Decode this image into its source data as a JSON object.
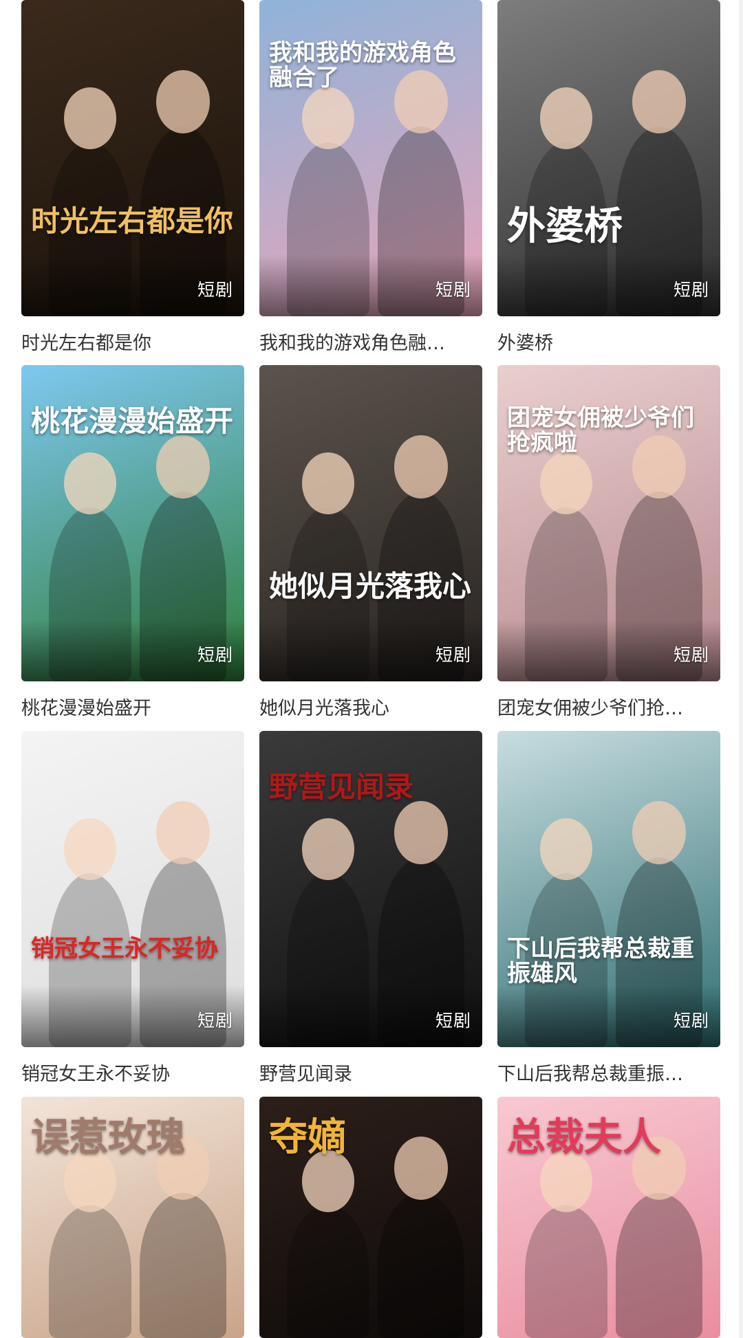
{
  "badge_label": "短剧",
  "cards": [
    {
      "title": "时光左右都是你",
      "poster_text": "时光左右都是你",
      "theme": [
        "#3b2a1c",
        "#1a120b"
      ],
      "accent": "#f0c060"
    },
    {
      "title": "我和我的游戏角色融…",
      "poster_text": "我和我的游戏角色融合了",
      "theme": [
        "#8fb3d9",
        "#e9a5b9"
      ],
      "accent": "#ffffff"
    },
    {
      "title": "外婆桥",
      "poster_text": "外婆桥",
      "theme": [
        "#7d7d7d",
        "#2f2f2f"
      ],
      "accent": "#ffffff"
    },
    {
      "title": "桃花漫漫始盛开",
      "poster_text": "桃花漫漫始盛开",
      "theme": [
        "#7ec8f0",
        "#2f7d3a"
      ],
      "accent": "#ffffff"
    },
    {
      "title": "她似月光落我心",
      "poster_text": "她似月光落我心",
      "theme": [
        "#5b534c",
        "#2a2522"
      ],
      "accent": "#ffffff"
    },
    {
      "title": "团宠女佣被少爷们抢…",
      "poster_text": "团宠女佣被少爷们抢疯啦",
      "theme": [
        "#e9cfcf",
        "#b98a8f"
      ],
      "accent": "#ffffff"
    },
    {
      "title": "销冠女王永不妥协",
      "poster_text": "销冠女王永不妥协",
      "theme": [
        "#f4f4f4",
        "#dddddd"
      ],
      "accent": "#e02424"
    },
    {
      "title": "野营见闻录",
      "poster_text": "野营见闻录",
      "theme": [
        "#3a3a3a",
        "#111111"
      ],
      "accent": "#b01818"
    },
    {
      "title": "下山后我帮总裁重振…",
      "poster_text": "下山后我帮总裁重振雄风",
      "theme": [
        "#c8dde0",
        "#2f6f73"
      ],
      "accent": "#ffffff"
    },
    {
      "title": "",
      "poster_text": "误惹玫瑰",
      "theme": [
        "#f3e4d8",
        "#c9a48a"
      ],
      "accent": "#a07a6a"
    },
    {
      "title": "",
      "poster_text": "夺嫡",
      "theme": [
        "#2d1f1a",
        "#0e0b0a"
      ],
      "accent": "#f0b43a"
    },
    {
      "title": "",
      "poster_text": "总裁夫人",
      "theme": [
        "#f8c9d2",
        "#e98ea0"
      ],
      "accent": "#e23b5a"
    }
  ]
}
